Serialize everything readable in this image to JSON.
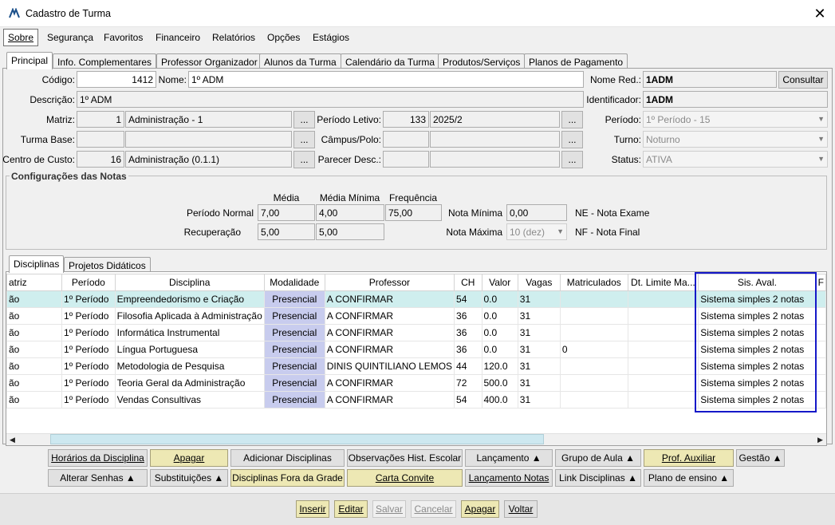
{
  "window": {
    "title": "Cadastro de Turma",
    "close": "✕"
  },
  "menu": [
    "Sobre",
    "Segurança",
    "Favoritos",
    "Financeiro",
    "Relatórios",
    "Opções",
    "Estágios"
  ],
  "tabs": [
    "Principal",
    "Info. Complementares",
    "Professor Organizador",
    "Alunos da Turma",
    "Calendário da Turma",
    "Produtos/Serviços",
    "Planos de Pagamento"
  ],
  "form": {
    "codigo_label": "Código:",
    "codigo": "1412",
    "nome_label": "Nome:",
    "nome": "1º ADM",
    "nome_red_label": "Nome Red.:",
    "nome_red": "1ADM",
    "consultar": "Consultar",
    "descricao_label": "Descrição:",
    "descricao": "1º ADM",
    "identificador_label": "Identificador:",
    "identificador": "1ADM",
    "matriz_label": "Matriz:",
    "matriz_num": "1",
    "matriz_nome": "Administração - 1",
    "periodo_letivo_label": "Período Letivo:",
    "periodo_letivo_num": "133",
    "periodo_letivo_nome": "2025/2",
    "periodo_label": "Período:",
    "periodo": "1º Período - 15",
    "turma_base_label": "Turma Base:",
    "campus_label": "Câmpus/Polo:",
    "turno_label": "Turno:",
    "turno": "Noturno",
    "centro_custo_label": "Centro de Custo:",
    "centro_custo_num": "16",
    "centro_custo_nome": "Administração (0.1.1)",
    "parecer_label": "Parecer Desc.:",
    "status_label": "Status:",
    "status": "ATIVA",
    "ellipsis": "..."
  },
  "notas": {
    "group_title": "Configurações das Notas",
    "media_header": "Média",
    "media_min_header": "Média Mínima",
    "frequencia_header": "Frequência",
    "periodo_normal_label": "Período Normal",
    "pn_media": "7,00",
    "pn_media_min": "4,00",
    "pn_frequencia": "75,00",
    "recuperacao_label": "Recuperação",
    "rec_media": "5,00",
    "rec_media_min": "5,00",
    "nota_minima_label": "Nota Mínima",
    "nota_minima": "0,00",
    "nota_maxima_label": "Nota Máxima",
    "nota_maxima": "10 (dez)",
    "ne_legend": "NE - Nota Exame",
    "nf_legend": "NF - Nota Final"
  },
  "inner_tabs": [
    "Disciplinas",
    "Projetos Didáticos"
  ],
  "grid": {
    "headers": [
      "atriz",
      "Período",
      "Disciplina",
      "Modalidade",
      "Professor",
      "CH",
      "Valor",
      "Vagas",
      "Matriculados",
      "Dt. Limite Ma...",
      "Sis. Aval.",
      "F"
    ],
    "rows": [
      [
        "ão",
        "1º Período",
        "Empreendedorismo e Criação",
        "Presencial",
        "A CONFIRMAR",
        "54",
        "0.0",
        "31",
        "",
        "",
        "Sistema simples 2 notas",
        ""
      ],
      [
        "ão",
        "1º Período",
        "Filosofia Aplicada à Administração",
        "Presencial",
        "A CONFIRMAR",
        "36",
        "0.0",
        "31",
        "",
        "",
        "Sistema simples 2 notas",
        ""
      ],
      [
        "ão",
        "1º Período",
        "Informática Instrumental",
        "Presencial",
        "A CONFIRMAR",
        "36",
        "0.0",
        "31",
        "",
        "",
        "Sistema simples 2 notas",
        ""
      ],
      [
        "ão",
        "1º Período",
        "Língua Portuguesa",
        "Presencial",
        "A CONFIRMAR",
        "36",
        "0.0",
        "31",
        "0",
        "",
        "Sistema simples 2 notas",
        ""
      ],
      [
        "ão",
        "1º Período",
        "Metodologia de Pesquisa",
        "Presencial",
        "DINIS QUINTILIANO LEMOS",
        "44",
        "120.0",
        "31",
        "",
        "",
        "Sistema simples 2 notas",
        ""
      ],
      [
        "ão",
        "1º Período",
        "Teoria Geral da Administração",
        "Presencial",
        "A CONFIRMAR",
        "72",
        "500.0",
        "31",
        "",
        "",
        "Sistema simples 2 notas",
        ""
      ],
      [
        "ão",
        "1º Período",
        "Vendas Consultivas",
        "Presencial",
        "A CONFIRMAR",
        "54",
        "400.0",
        "31",
        "",
        "",
        "Sistema simples 2 notas",
        ""
      ]
    ]
  },
  "action_buttons": {
    "horarios": "Horários da Disciplina",
    "apagar": "Apagar",
    "adicionar": "Adicionar Disciplinas",
    "observacoes": "Observações Hist. Escolar",
    "lancamento": "Lançamento ▲",
    "grupo_aula": "Grupo de Aula ▲",
    "prof_auxiliar": "Prof. Auxiliar",
    "gestao": "Gestão ▲",
    "alterar_senhas": "Alterar Senhas ▲",
    "substituicoes": "Substituições ▲",
    "fora_grade": "Disciplinas Fora da Grade",
    "carta_convite": "Carta Convite",
    "lancamento_notas": "Lançamento Notas",
    "link_disciplinas": "Link Disciplinas ▲",
    "plano_ensino": "Plano de ensino ▲"
  },
  "footer_buttons": {
    "inserir": "Inserir",
    "editar": "Editar",
    "salvar": "Salvar",
    "cancelar": "Cancelar",
    "apagar": "Apagar",
    "voltar": "Voltar"
  },
  "colors": {
    "highlight": "#1518c8",
    "selected_row": "#cfeeee",
    "modalidade": "#c8ccee",
    "yellow_button": "#ede8b4"
  }
}
